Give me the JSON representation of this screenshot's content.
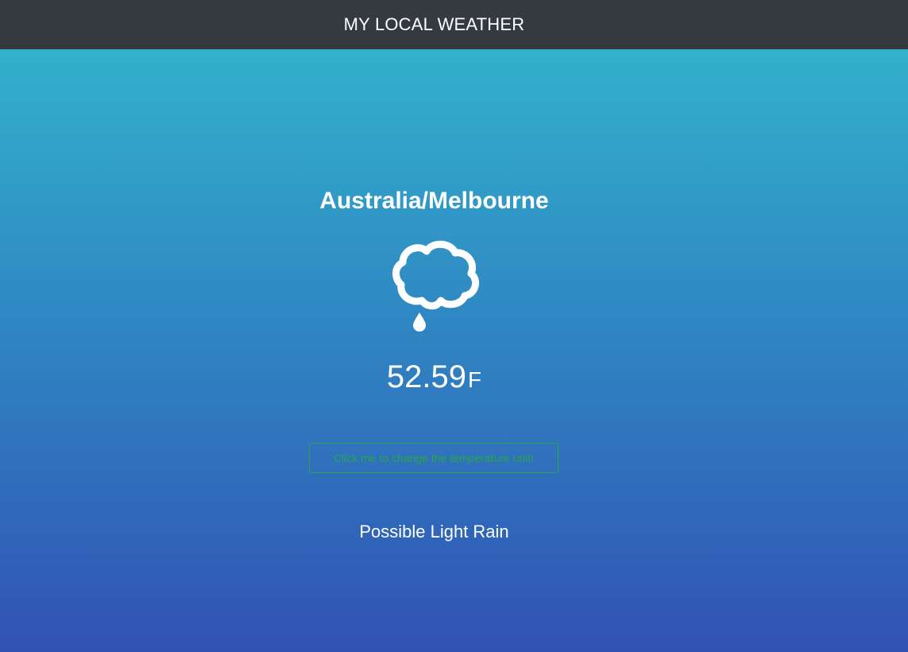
{
  "navbar": {
    "title": "MY LOCAL WEATHER"
  },
  "weather": {
    "location": "Australia/Melbourne",
    "icon": "cloud-rain-drop-icon",
    "temperature": "52.59",
    "unit": "F",
    "summary": "Possible Light Rain"
  },
  "controls": {
    "toggle_unit_label": "Click me to change the temperature unit!"
  },
  "colors": {
    "navbar_bg": "#343a40",
    "gradient_top": "#33b1cb",
    "gradient_bottom": "#3152b4",
    "button_accent": "#28a745",
    "text": "#ffffff"
  }
}
